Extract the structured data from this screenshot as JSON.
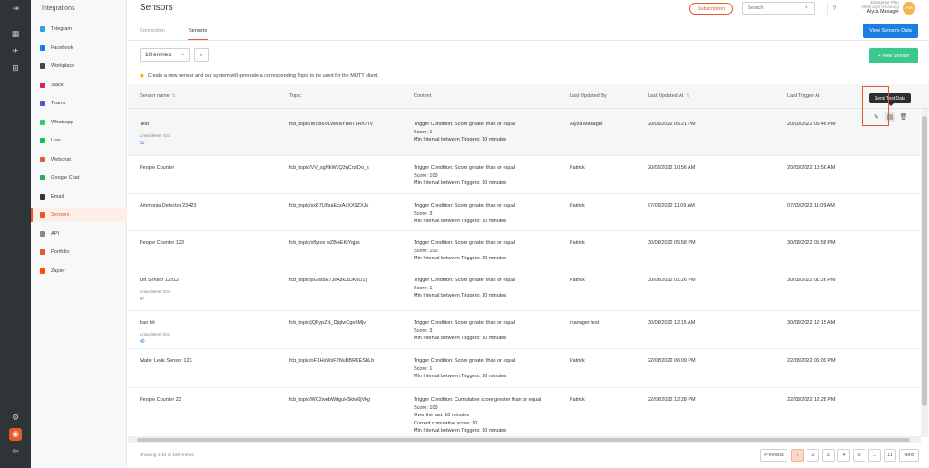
{
  "rail": {
    "icons": [
      "collapse-icon",
      "dashboard-icon",
      "rocket-icon",
      "hierarchy-icon",
      "settings-icon",
      "sensor-app-icon",
      "logout-icon"
    ]
  },
  "sidebar": {
    "title": "Integrations",
    "items": [
      {
        "label": "Telegram",
        "color": "#2aa3df"
      },
      {
        "label": "Facebook",
        "color": "#1877f2"
      },
      {
        "label": "Workplace",
        "color": "#444444"
      },
      {
        "label": "Slack",
        "color": "#e01e5a"
      },
      {
        "label": "Teams",
        "color": "#5059c9"
      },
      {
        "label": "Whatsapp",
        "color": "#25d366"
      },
      {
        "label": "Line",
        "color": "#06c755"
      },
      {
        "label": "Webchat",
        "color": "#e55a2b"
      },
      {
        "label": "Google Chat",
        "color": "#34a853"
      },
      {
        "label": "Email",
        "color": "#333333"
      },
      {
        "label": "Sensors",
        "color": "#e55a2b"
      },
      {
        "label": "API",
        "color": "#888888"
      },
      {
        "label": "Portfolio",
        "color": "#e55a2b"
      },
      {
        "label": "Zapier",
        "color": "#ff4a00"
      }
    ]
  },
  "header": {
    "title": "Sensors",
    "subscription": "Subscription",
    "search_placeholder": "Search",
    "help": "?",
    "plan": "Enterprise Plan",
    "days": "(9999 days remaining)",
    "user": "Alyza Manager",
    "avatar": "AM"
  },
  "tabs": {
    "connection": "Connection",
    "sensors": "Sensors"
  },
  "view_btn": "View Sensors Data",
  "new_btn": "+ New Sensor",
  "entries": "10 entries",
  "info": "Create a new sensor and our system will generate a corresponding Topic to be used for the MQTT client.",
  "columns": {
    "name": "Sensor name",
    "topic": "Topic",
    "content": "Content",
    "updated_by": "Last Updated By",
    "updated_at": "Last Updated At",
    "trigger_at": "Last Trigger At"
  },
  "tooltip": "Send Test Data",
  "rows": [
    {
      "name": "Test",
      "linked": "Linked Meter IDs:",
      "meter": "52",
      "topic": "fcb_topic/WSb6V1vwkaYBwTLRn7Tv",
      "content": [
        "Trigger Condition: Score greater than or equal",
        "Score: 1",
        "Min Interval between Triggers: 10 minutes"
      ],
      "by": "Alyza Manager",
      "at": "20/09/2022 05:21 PM",
      "trig": "20/09/2022 05:46 PM"
    },
    {
      "name": "People Counter",
      "linked": "",
      "meter": "",
      "topic": "fcb_topic/VV_sgNkWcQ3qCrztDo_s",
      "content": [
        "Trigger Condition: Score greater than or equal",
        "Score: 100",
        "Min Interval between Triggers: 10 minutes"
      ],
      "by": "Patrick",
      "at": "20/09/2022 10:56 AM",
      "trig": "20/09/2022 10:56 AM"
    },
    {
      "name": "Ammonia Detector 23423",
      "linked": "",
      "meter": "",
      "topic": "fcb_topic/sxB7U6saEczAcXX9ZXJu",
      "content": [
        "Trigger Condition: Score greater than or equal",
        "Score: 3",
        "Min Interval between Triggers: 10 minutes"
      ],
      "by": "Patrick",
      "at": "07/09/2022 11:09 AM",
      "trig": "07/09/2022 11:09 AM"
    },
    {
      "name": "People Counter 123",
      "linked": "",
      "meter": "",
      "topic": "fcb_topic/xflyrov wZBwEKtYqjzs",
      "content": [
        "Trigger Condition: Score greater than or equal",
        "Score: 100",
        "Min Interval between Triggers: 10 minutes"
      ],
      "by": "Patrick",
      "at": "30/08/2022 05:58 PM",
      "trig": "30/08/2022 05:58 PM"
    },
    {
      "name": "Lift Sensor 12312",
      "linked": "Linked Meter IDs:",
      "meter": "47",
      "topic": "fcb_topic/pG3s8E7JsAzkJ8JKnU1y",
      "content": [
        "Trigger Condition: Score greater than or equal",
        "Score: 1",
        "Min Interval between Triggers: 10 minutes"
      ],
      "by": "Patrick",
      "at": "30/08/2022 01:26 PM",
      "trig": "30/08/2022 01:26 PM"
    },
    {
      "name": "bao tét",
      "linked": "Linked Meter IDs:",
      "meter": "49",
      "topic": "fcb_topic/jQFypZN_DjqIwCgehMjv",
      "content": [
        "Trigger Condition: Score greater than or equal",
        "Score: 3",
        "Min Interval between Triggers: 10 minutes"
      ],
      "by": "manager test",
      "at": "30/08/2022 12:15 AM",
      "trig": "30/08/2022 12:15 AM"
    },
    {
      "name": "Water Leak Sensor 123",
      "linked": "",
      "meter": "",
      "topic": "fcb_topic/oFXHsWsF2NuBBRKESbLb",
      "content": [
        "Trigger Condition: Score greater than or equal",
        "Score: 1",
        "Min Interval between Triggers: 10 minutes"
      ],
      "by": "Patrick",
      "at": "22/08/2022 06:09 PM",
      "trig": "22/08/2022 06:09 PM"
    },
    {
      "name": "People Counter 23",
      "linked": "",
      "meter": "",
      "topic": "fcb_topic/WC2webWdguH5kiw6jVkg",
      "content": [
        "Trigger Condition: Cumulative score greater than or equal",
        "Score: 100",
        "Over the last: 10 minutes",
        "Current cumulative score: 10",
        "Min Interval between Triggers: 10 minutes"
      ],
      "by": "Patrick",
      "at": "22/08/2022 12:28 PM",
      "trig": "22/08/2022 12:28 PM"
    }
  ],
  "footer": {
    "showing": "Showing 1-10 of 108 entries",
    "prev": "Previous",
    "pages": [
      "1",
      "2",
      "3",
      "4",
      "5",
      "…",
      "11"
    ],
    "next": "Next"
  }
}
